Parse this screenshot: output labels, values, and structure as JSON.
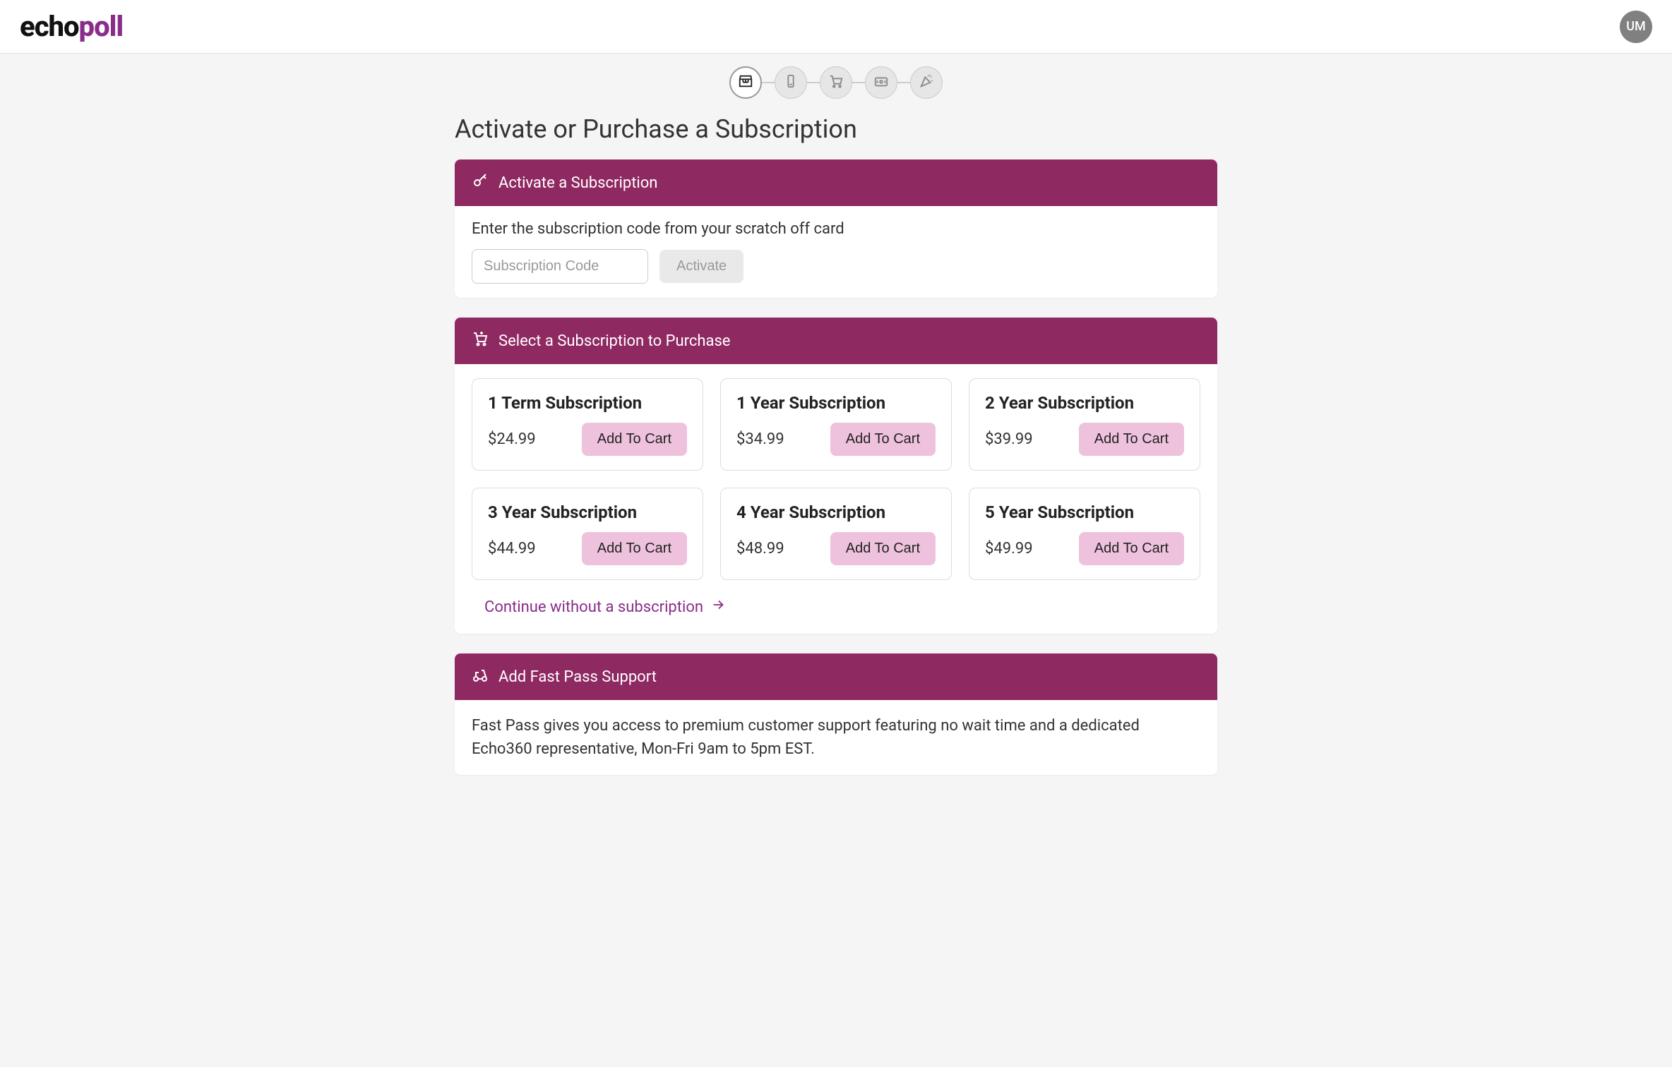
{
  "header": {
    "logo_part1": "echo",
    "logo_part2": "poll",
    "avatar_initials": "UM"
  },
  "page_title": "Activate or Purchase a Subscription",
  "activate": {
    "header": "Activate a Subscription",
    "instruction": "Enter the subscription code from your scratch off card",
    "placeholder": "Subscription Code",
    "button": "Activate"
  },
  "select": {
    "header": "Select a Subscription to Purchase",
    "add_label": "Add To Cart",
    "continue_label": "Continue without a subscription",
    "plans": [
      {
        "title": "1 Term Subscription",
        "price": "$24.99"
      },
      {
        "title": "1 Year Subscription",
        "price": "$34.99"
      },
      {
        "title": "2 Year Subscription",
        "price": "$39.99"
      },
      {
        "title": "3 Year Subscription",
        "price": "$44.99"
      },
      {
        "title": "4 Year Subscription",
        "price": "$48.99"
      },
      {
        "title": "5 Year Subscription",
        "price": "$49.99"
      }
    ]
  },
  "fastpass": {
    "header": "Add Fast Pass Support",
    "body": "Fast Pass gives you access to premium customer support featuring no wait time and a dedicated Echo360 representative, Mon-Fri 9am to 5pm EST."
  }
}
